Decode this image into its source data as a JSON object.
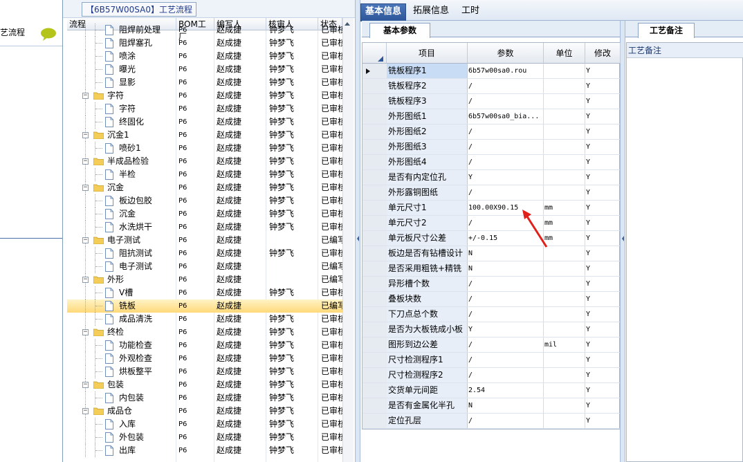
{
  "left_panel": {
    "title": "艺流程"
  },
  "tree": {
    "title": "【6B57W00SA0】工艺流程",
    "columns": {
      "flow": "流程",
      "bom": "BOM工厂",
      "writer": "编写人",
      "reviewer": "核审人",
      "status": "状态"
    },
    "rows": [
      {
        "name": "阻焊前处理",
        "level": 2,
        "type": "doc",
        "bom": "P6",
        "writer": "赵成捷",
        "reviewer": "钟梦飞",
        "status": "已审核"
      },
      {
        "name": "阻焊塞孔",
        "level": 2,
        "type": "doc",
        "bom": "P6",
        "writer": "赵成捷",
        "reviewer": "钟梦飞",
        "status": "已审核"
      },
      {
        "name": "喷涂",
        "level": 2,
        "type": "doc",
        "bom": "P6",
        "writer": "赵成捷",
        "reviewer": "钟梦飞",
        "status": "已审核"
      },
      {
        "name": "曝光",
        "level": 2,
        "type": "doc",
        "bom": "P6",
        "writer": "赵成捷",
        "reviewer": "钟梦飞",
        "status": "已审核"
      },
      {
        "name": "显影",
        "level": 2,
        "type": "doc",
        "bom": "P6",
        "writer": "赵成捷",
        "reviewer": "钟梦飞",
        "status": "已审核"
      },
      {
        "name": "字符",
        "level": 1,
        "type": "folder",
        "bom": "P6",
        "writer": "赵成捷",
        "reviewer": "钟梦飞",
        "status": "已审核"
      },
      {
        "name": "字符",
        "level": 2,
        "type": "doc",
        "bom": "P6",
        "writer": "赵成捷",
        "reviewer": "钟梦飞",
        "status": "已审核"
      },
      {
        "name": "终固化",
        "level": 2,
        "type": "doc",
        "bom": "P6",
        "writer": "赵成捷",
        "reviewer": "钟梦飞",
        "status": "已审核"
      },
      {
        "name": "沉金1",
        "level": 1,
        "type": "folder",
        "bom": "P6",
        "writer": "赵成捷",
        "reviewer": "钟梦飞",
        "status": "已审核"
      },
      {
        "name": "喷砂1",
        "level": 2,
        "type": "doc",
        "bom": "P6",
        "writer": "赵成捷",
        "reviewer": "钟梦飞",
        "status": "已审核"
      },
      {
        "name": "半成品检验",
        "level": 1,
        "type": "folder",
        "bom": "P6",
        "writer": "赵成捷",
        "reviewer": "钟梦飞",
        "status": "已审核"
      },
      {
        "name": "半检",
        "level": 2,
        "type": "doc",
        "bom": "P6",
        "writer": "赵成捷",
        "reviewer": "钟梦飞",
        "status": "已审核"
      },
      {
        "name": "沉金",
        "level": 1,
        "type": "folder",
        "bom": "P6",
        "writer": "赵成捷",
        "reviewer": "钟梦飞",
        "status": "已审核"
      },
      {
        "name": "板边包胶",
        "level": 2,
        "type": "doc",
        "bom": "P6",
        "writer": "赵成捷",
        "reviewer": "钟梦飞",
        "status": "已审核"
      },
      {
        "name": "沉金",
        "level": 2,
        "type": "doc",
        "bom": "P6",
        "writer": "赵成捷",
        "reviewer": "钟梦飞",
        "status": "已审核"
      },
      {
        "name": "水洗烘干",
        "level": 2,
        "type": "doc",
        "bom": "P6",
        "writer": "赵成捷",
        "reviewer": "钟梦飞",
        "status": "已审核"
      },
      {
        "name": "电子测试",
        "level": 1,
        "type": "folder",
        "bom": "P6",
        "writer": "赵成捷",
        "reviewer": "",
        "status": "已编写"
      },
      {
        "name": "阻抗测试",
        "level": 2,
        "type": "doc",
        "bom": "P6",
        "writer": "赵成捷",
        "reviewer": "钟梦飞",
        "status": "已审核"
      },
      {
        "name": "电子测试",
        "level": 2,
        "type": "doc",
        "bom": "P6",
        "writer": "赵成捷",
        "reviewer": "",
        "status": "已编写"
      },
      {
        "name": "外形",
        "level": 1,
        "type": "folder",
        "bom": "P6",
        "writer": "赵成捷",
        "reviewer": "",
        "status": "已编写"
      },
      {
        "name": "V槽",
        "level": 2,
        "type": "doc",
        "bom": "P6",
        "writer": "赵成捷",
        "reviewer": "钟梦飞",
        "status": "已审核"
      },
      {
        "name": "铣板",
        "level": 2,
        "type": "doc",
        "bom": "P6",
        "writer": "赵成捷",
        "reviewer": "",
        "status": "已编写",
        "selected": true
      },
      {
        "name": "成品清洗",
        "level": 2,
        "type": "doc",
        "bom": "P6",
        "writer": "赵成捷",
        "reviewer": "钟梦飞",
        "status": "已审核"
      },
      {
        "name": "终检",
        "level": 1,
        "type": "folder",
        "bom": "P6",
        "writer": "赵成捷",
        "reviewer": "钟梦飞",
        "status": "已审核"
      },
      {
        "name": "功能检查",
        "level": 2,
        "type": "doc",
        "bom": "P6",
        "writer": "赵成捷",
        "reviewer": "钟梦飞",
        "status": "已审核"
      },
      {
        "name": "外观检查",
        "level": 2,
        "type": "doc",
        "bom": "P6",
        "writer": "赵成捷",
        "reviewer": "钟梦飞",
        "status": "已审核"
      },
      {
        "name": "烘板整平",
        "level": 2,
        "type": "doc",
        "bom": "P6",
        "writer": "赵成捷",
        "reviewer": "钟梦飞",
        "status": "已审核"
      },
      {
        "name": "包装",
        "level": 1,
        "type": "folder",
        "bom": "P6",
        "writer": "赵成捷",
        "reviewer": "钟梦飞",
        "status": "已审核"
      },
      {
        "name": "内包装",
        "level": 2,
        "type": "doc",
        "bom": "P6",
        "writer": "赵成捷",
        "reviewer": "钟梦飞",
        "status": "已审核"
      },
      {
        "name": "成品仓",
        "level": 1,
        "type": "folder",
        "bom": "P6",
        "writer": "赵成捷",
        "reviewer": "钟梦飞",
        "status": "已审核"
      },
      {
        "name": "入库",
        "level": 2,
        "type": "doc",
        "bom": "P6",
        "writer": "赵成捷",
        "reviewer": "钟梦飞",
        "status": "已审核"
      },
      {
        "name": "外包装",
        "level": 2,
        "type": "doc",
        "bom": "P6",
        "writer": "赵成捷",
        "reviewer": "钟梦飞",
        "status": "已审核"
      },
      {
        "name": "出库",
        "level": 2,
        "type": "doc",
        "bom": "P6",
        "writer": "赵成捷",
        "reviewer": "钟梦飞",
        "status": "已审核"
      }
    ]
  },
  "tabs": {
    "basic": "基本信息",
    "extended": "拓展信息",
    "hours": "工时"
  },
  "subtab": "基本参数",
  "params": {
    "columns": {
      "item": "项目",
      "param": "参数",
      "unit": "单位",
      "modify": "修改"
    },
    "rows": [
      {
        "item": "铣板程序1",
        "param": "6b57w00sa0.rou",
        "unit": "",
        "modify": "Y"
      },
      {
        "item": "铣板程序2",
        "param": "/",
        "unit": "",
        "modify": "Y"
      },
      {
        "item": "铣板程序3",
        "param": "/",
        "unit": "",
        "modify": "Y"
      },
      {
        "item": "外形图纸1",
        "param": "6b57w00sa0_bia...",
        "unit": "",
        "modify": "Y"
      },
      {
        "item": "外形图纸2",
        "param": "/",
        "unit": "",
        "modify": "Y"
      },
      {
        "item": "外形图纸3",
        "param": "/",
        "unit": "",
        "modify": "Y"
      },
      {
        "item": "外形图纸4",
        "param": "/",
        "unit": "",
        "modify": "Y"
      },
      {
        "item": "是否有内定位孔",
        "param": "Y",
        "unit": "",
        "modify": "Y"
      },
      {
        "item": "外形露铜图纸",
        "param": "/",
        "unit": "",
        "modify": "Y"
      },
      {
        "item": "单元尺寸1",
        "param": "100.00X90.15",
        "unit": "mm",
        "modify": "Y"
      },
      {
        "item": "单元尺寸2",
        "param": "/",
        "unit": "mm",
        "modify": "Y"
      },
      {
        "item": "单元板尺寸公差",
        "param": "+/-0.15",
        "unit": "mm",
        "modify": "Y"
      },
      {
        "item": "板边是否有钻槽设计",
        "param": "N",
        "unit": "",
        "modify": "Y"
      },
      {
        "item": "是否采用粗铣+精铣",
        "param": "N",
        "unit": "",
        "modify": "Y"
      },
      {
        "item": "异形槽个数",
        "param": "/",
        "unit": "",
        "modify": "Y"
      },
      {
        "item": "叠板块数",
        "param": "/",
        "unit": "",
        "modify": "Y"
      },
      {
        "item": "下刀点总个数",
        "param": "/",
        "unit": "",
        "modify": "Y"
      },
      {
        "item": "是否为大板铣成小板",
        "param": "Y",
        "unit": "",
        "modify": "Y"
      },
      {
        "item": "图形到边公差",
        "param": "/",
        "unit": "mil",
        "modify": "Y"
      },
      {
        "item": "尺寸检测程序1",
        "param": "/",
        "unit": "",
        "modify": "Y"
      },
      {
        "item": "尺寸检测程序2",
        "param": "/",
        "unit": "",
        "modify": "Y"
      },
      {
        "item": "交货单元间距",
        "param": "2.54",
        "unit": "",
        "modify": "Y"
      },
      {
        "item": "是否有金属化半孔",
        "param": "N",
        "unit": "",
        "modify": "Y"
      },
      {
        "item": "定位孔层",
        "param": "/",
        "unit": "",
        "modify": "Y"
      }
    ]
  },
  "remarks": {
    "tab": "工艺备注",
    "header": "工艺备注"
  },
  "colors": {
    "accent": "#2e569a",
    "annotation_arrow": "#e0201a",
    "selected_row": "#ffd97a"
  }
}
